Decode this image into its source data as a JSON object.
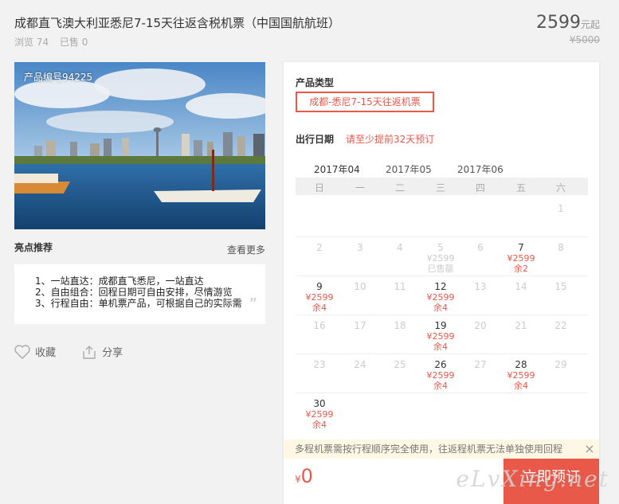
{
  "product": {
    "title": "成都直飞澳大利亚悉尼7-15天往返含税机票（中国国航航班）",
    "views": "浏览 74",
    "sold": "已售 0",
    "price": "2599",
    "price_unit": "元起",
    "original_price": "¥5000",
    "photo_code": "产品编号94225"
  },
  "highlights": {
    "title": "亮点推荐",
    "more": "查看更多",
    "items": [
      "1、一站直达：成都直飞悉尼，一站直达",
      "2、自由组合：回程日期可自由安排，尽情游览",
      "3、行程自由：单机票产品，可根据自己的实际需"
    ]
  },
  "actions": {
    "favorite": "收藏",
    "share": "分享"
  },
  "booking": {
    "type_label": "产品类型",
    "type_option": "成都-悉尼7-15天往返机票",
    "date_label": "出行日期",
    "date_note": "请至少提前32天预订",
    "months": [
      "2017年04",
      "2017年05",
      "2017年06"
    ],
    "weekdays": [
      "日",
      "一",
      "二",
      "三",
      "四",
      "五",
      "六"
    ],
    "notice": "多程机票需按行程顺序完全使用，往返程机票无法单独使用回程",
    "close": "×",
    "total_symbol": "¥",
    "total": "0",
    "book_button": "立即预订"
  },
  "calendar": [
    {
      "day": "1",
      "col": 6,
      "row": 0
    },
    {
      "day": "2",
      "col": 0,
      "row": 1
    },
    {
      "day": "3",
      "col": 1,
      "row": 1
    },
    {
      "day": "4",
      "col": 2,
      "row": 1
    },
    {
      "day": "5",
      "col": 3,
      "row": 1,
      "price": "¥2599",
      "remain": "已售罄",
      "sold": true
    },
    {
      "day": "6",
      "col": 4,
      "row": 1
    },
    {
      "day": "7",
      "col": 5,
      "row": 1,
      "price": "¥2599",
      "remain": "余2"
    },
    {
      "day": "8",
      "col": 6,
      "row": 1
    },
    {
      "day": "9",
      "col": 0,
      "row": 2,
      "price": "¥2599",
      "remain": "余4"
    },
    {
      "day": "10",
      "col": 1,
      "row": 2
    },
    {
      "day": "11",
      "col": 2,
      "row": 2
    },
    {
      "day": "12",
      "col": 3,
      "row": 2,
      "price": "¥2599",
      "remain": "余4"
    },
    {
      "day": "13",
      "col": 4,
      "row": 2
    },
    {
      "day": "14",
      "col": 5,
      "row": 2
    },
    {
      "day": "15",
      "col": 6,
      "row": 2
    },
    {
      "day": "16",
      "col": 0,
      "row": 3
    },
    {
      "day": "17",
      "col": 1,
      "row": 3
    },
    {
      "day": "18",
      "col": 2,
      "row": 3
    },
    {
      "day": "19",
      "col": 3,
      "row": 3,
      "price": "¥2599",
      "remain": "余4"
    },
    {
      "day": "20",
      "col": 4,
      "row": 3
    },
    {
      "day": "21",
      "col": 5,
      "row": 3
    },
    {
      "day": "22",
      "col": 6,
      "row": 3
    },
    {
      "day": "23",
      "col": 0,
      "row": 4
    },
    {
      "day": "24",
      "col": 1,
      "row": 4
    },
    {
      "day": "25",
      "col": 2,
      "row": 4
    },
    {
      "day": "26",
      "col": 3,
      "row": 4,
      "price": "¥2599",
      "remain": "余4"
    },
    {
      "day": "27",
      "col": 4,
      "row": 4
    },
    {
      "day": "28",
      "col": 5,
      "row": 4,
      "price": "¥2599",
      "remain": "余4"
    },
    {
      "day": "29",
      "col": 6,
      "row": 4
    },
    {
      "day": "30",
      "col": 0,
      "row": 5,
      "price": "¥2599",
      "remain": "余4"
    }
  ],
  "watermark": "eLvXing.net",
  "colors": {
    "accent": "#e8594a",
    "notice_bg": "#fdf7e3"
  }
}
